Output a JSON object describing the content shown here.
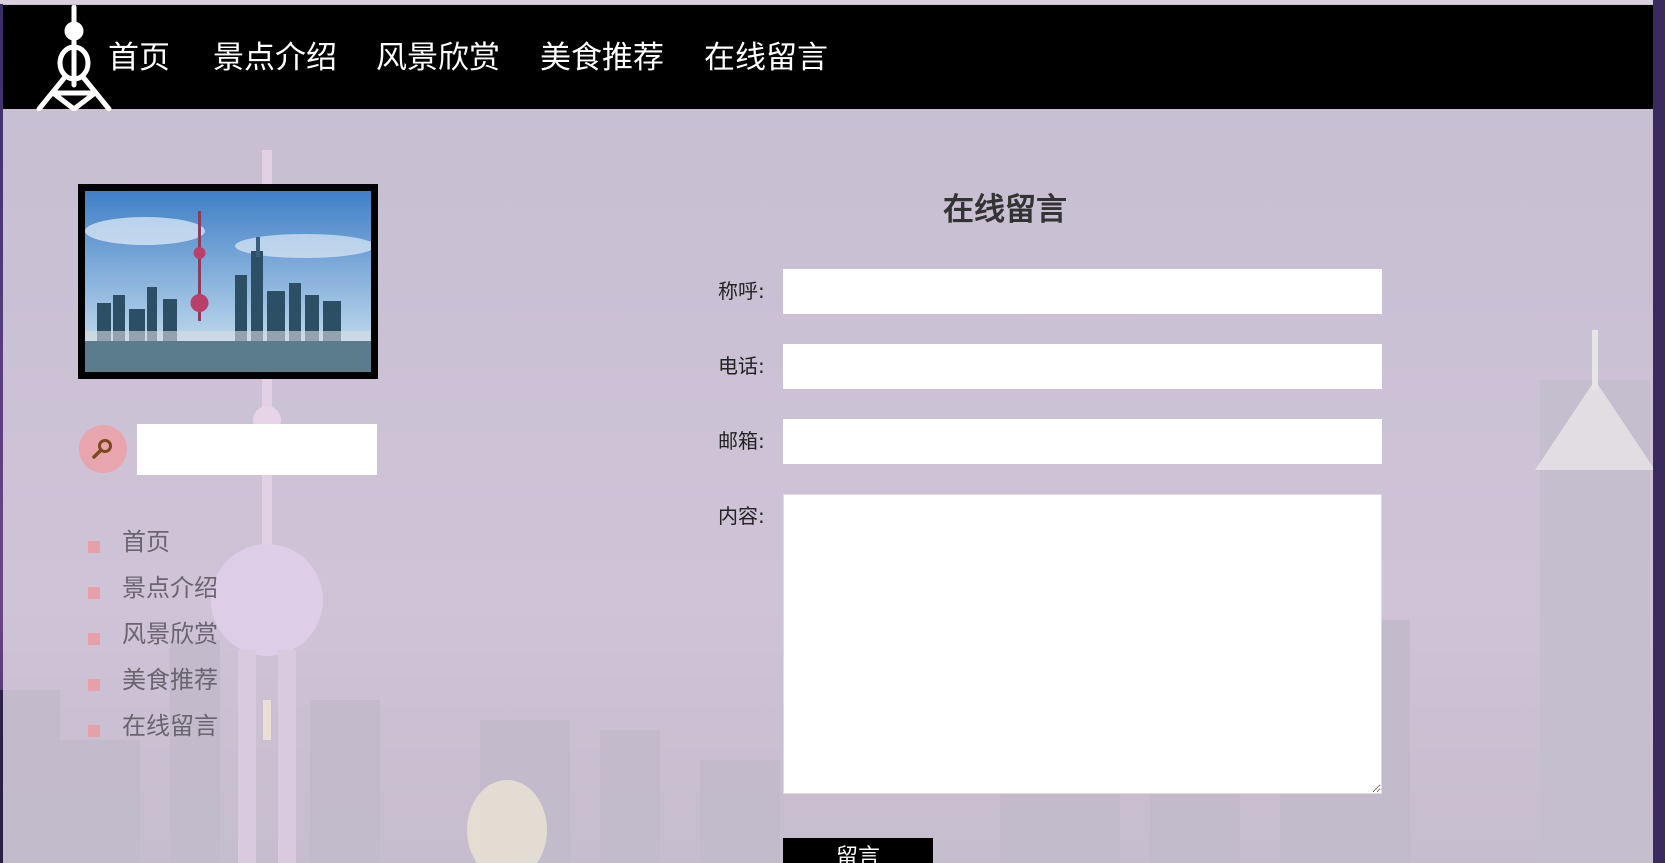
{
  "nav": {
    "items": [
      "首页",
      "景点介绍",
      "风景欣赏",
      "美食推荐",
      "在线留言"
    ]
  },
  "sidebar": {
    "search": {
      "value": "",
      "placeholder": ""
    },
    "menu": [
      "首页",
      "景点介绍",
      "风景欣赏",
      "美食推荐",
      "在线留言"
    ]
  },
  "form": {
    "title": "在线留言",
    "name_label": "称呼:",
    "phone_label": "电话:",
    "email_label": "邮箱:",
    "content_label": "内容:",
    "name_value": "",
    "phone_value": "",
    "email_value": "",
    "content_value": "",
    "submit_label": "留言"
  },
  "colors": {
    "navbar": "#000000",
    "accent": "#e8a0a8",
    "page_overlay": "#e8e2ec"
  },
  "icons": [
    "tower-logo-icon",
    "search-icon",
    "square-bullet-icon"
  ]
}
